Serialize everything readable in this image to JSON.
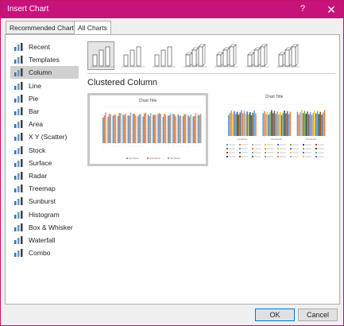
{
  "window": {
    "title": "Insert Chart",
    "help": "?",
    "close": "✕"
  },
  "tabs": [
    {
      "label": "Recommended Charts",
      "active": false
    },
    {
      "label": "All Charts",
      "active": true
    }
  ],
  "categories": [
    {
      "label": "Recent",
      "icon": "recent-icon"
    },
    {
      "label": "Templates",
      "icon": "templates-icon"
    },
    {
      "label": "Column",
      "icon": "column-chart-icon",
      "selected": true
    },
    {
      "label": "Line",
      "icon": "line-chart-icon"
    },
    {
      "label": "Pie",
      "icon": "pie-chart-icon"
    },
    {
      "label": "Bar",
      "icon": "bar-chart-icon"
    },
    {
      "label": "Area",
      "icon": "area-chart-icon"
    },
    {
      "label": "X Y (Scatter)",
      "icon": "scatter-chart-icon"
    },
    {
      "label": "Stock",
      "icon": "stock-chart-icon"
    },
    {
      "label": "Surface",
      "icon": "surface-chart-icon"
    },
    {
      "label": "Radar",
      "icon": "radar-chart-icon"
    },
    {
      "label": "Treemap",
      "icon": "treemap-chart-icon"
    },
    {
      "label": "Sunburst",
      "icon": "sunburst-chart-icon"
    },
    {
      "label": "Histogram",
      "icon": "histogram-chart-icon"
    },
    {
      "label": "Box & Whisker",
      "icon": "box-whisker-chart-icon"
    },
    {
      "label": "Waterfall",
      "icon": "waterfall-chart-icon"
    },
    {
      "label": "Combo",
      "icon": "combo-chart-icon"
    }
  ],
  "subtypes": [
    {
      "name": "Clustered Column",
      "selected": true
    },
    {
      "name": "Stacked Column"
    },
    {
      "name": "100% Stacked Column"
    },
    {
      "name": "3-D Clustered Column"
    },
    {
      "name": "3-D Stacked Column"
    },
    {
      "name": "3-D 100% Stacked Column"
    },
    {
      "name": "3-D Column"
    }
  ],
  "selected_heading": "Clustered Column",
  "previews": [
    {
      "title": "Chart Title",
      "legend": [
        "1st Score",
        "2nd Score",
        "3rd Score"
      ]
    },
    {
      "title": "Chart Title",
      "groups": [
        "1st Score",
        "2nd Score",
        "3rd Score"
      ]
    }
  ],
  "buttons": {
    "ok": "OK",
    "cancel": "Cancel"
  },
  "colors": {
    "titlebar": "#c7127a",
    "series": [
      "#5b9bd5",
      "#ed7d31",
      "#a5a5a5",
      "#ffc000",
      "#4472c4",
      "#70ad47",
      "#264478",
      "#9e480e",
      "#636363"
    ]
  }
}
